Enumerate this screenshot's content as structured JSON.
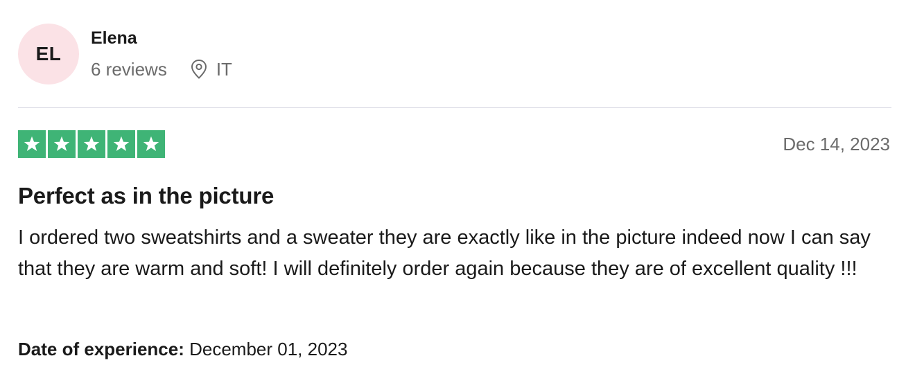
{
  "reviewer": {
    "initials": "EL",
    "name": "Elena",
    "reviews_count": "6 reviews",
    "location_icon": "location-pin-icon",
    "country": "IT",
    "avatar_color": "#fbe2e6"
  },
  "review": {
    "rating": 5,
    "rating_max": 5,
    "star_icon": "star-icon",
    "star_color": "#3fb476",
    "date": "Dec 14, 2023",
    "title": "Perfect as in the picture",
    "body": "I ordered two sweatshirts and a sweater they are exactly like in the picture indeed now I can say that they are warm and soft! I will definitely order again because they are of excellent quality !!!",
    "experience_label": "Date of experience:",
    "experience_date": "December 01, 2023"
  }
}
